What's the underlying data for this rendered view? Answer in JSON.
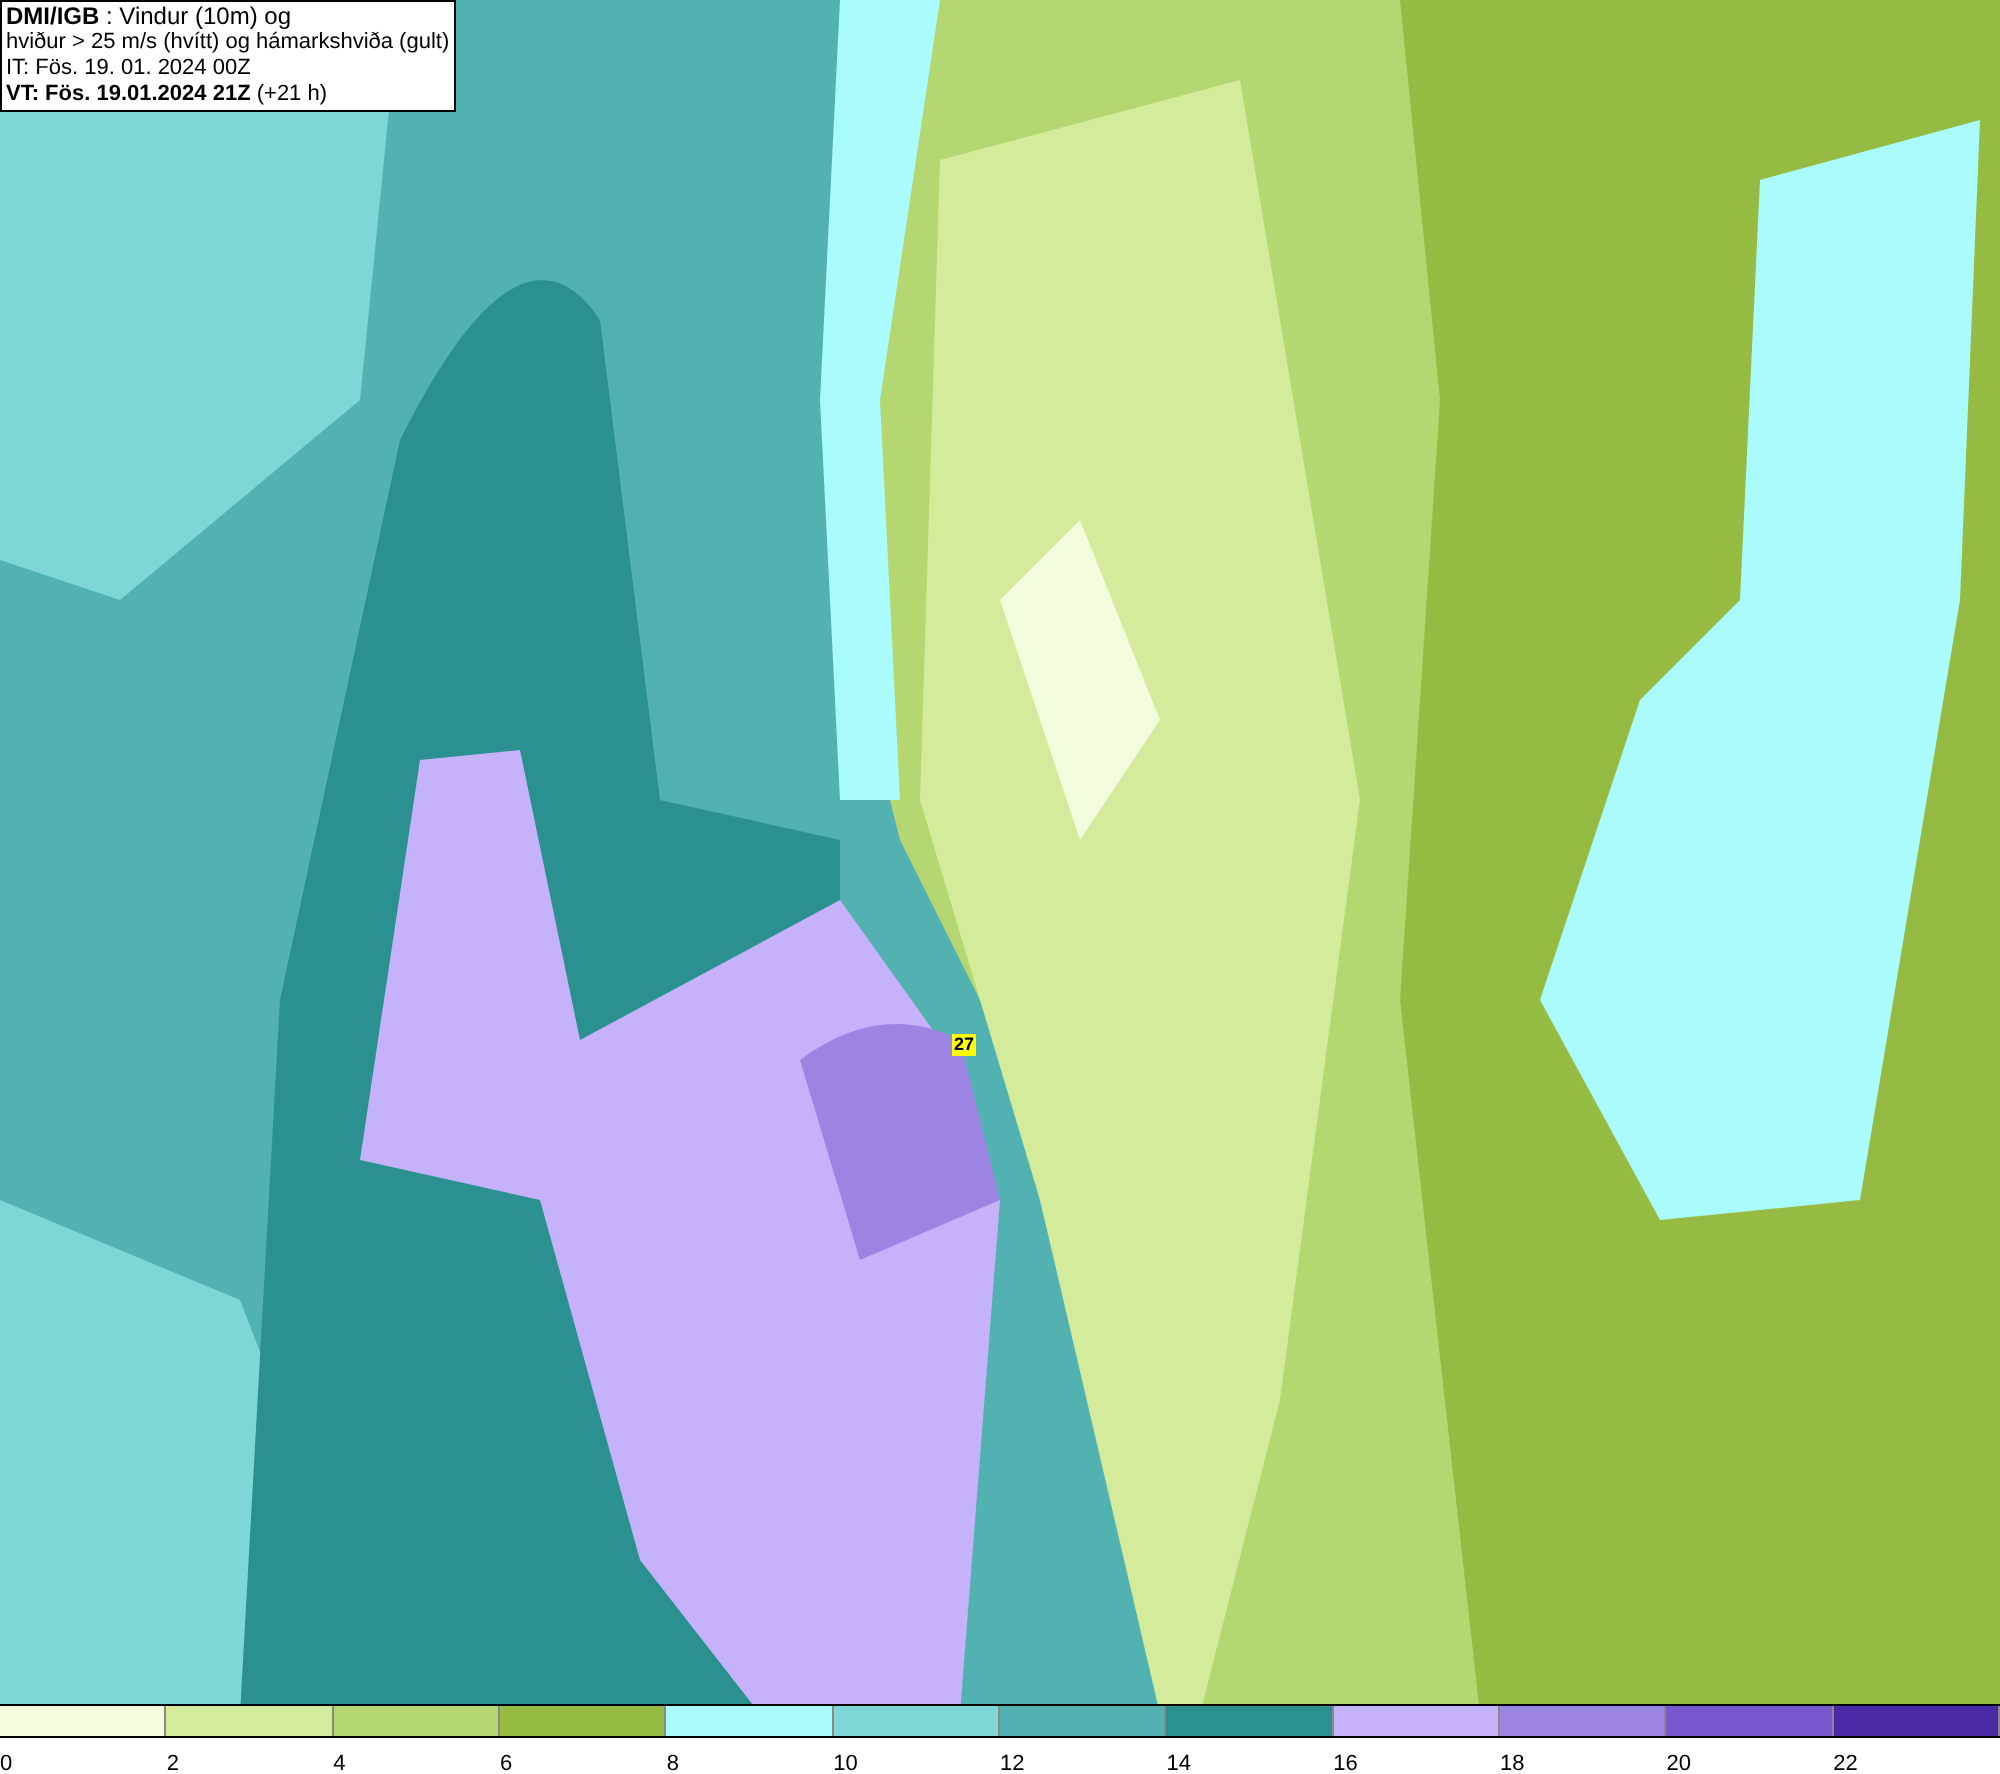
{
  "header": {
    "lines": [
      "**DMI/IGB** : Vindur (10m) og",
      "hviður > 25 m/s (hvítt) og hámarkshviða (gult)",
      "IT: Fös. 19. 01. 2024 00Z",
      "**VT: Fös. 19.01.2024 21Z** (+21 h)"
    ]
  },
  "map": {
    "gust_label": "27"
  },
  "legend": [
    {
      "label": "0",
      "color": "#f4fcde"
    },
    {
      "label": "2",
      "color": "#d3eb9b"
    },
    {
      "label": "4",
      "color": "#b4d772"
    },
    {
      "label": "6",
      "color": "#96bb42"
    },
    {
      "label": "8",
      "color": "#aafcfc"
    },
    {
      "label": "10",
      "color": "#7fd6d6"
    },
    {
      "label": "12",
      "color": "#52b2b2"
    },
    {
      "label": "14",
      "color": "#2a9090"
    },
    {
      "label": "16",
      "color": "#c6b2fa"
    },
    {
      "label": "18",
      "color": "#9c84e2"
    },
    {
      "label": "20",
      "color": "#7856ce"
    },
    {
      "label": "22",
      "color": "#4a2aa6"
    }
  ]
}
